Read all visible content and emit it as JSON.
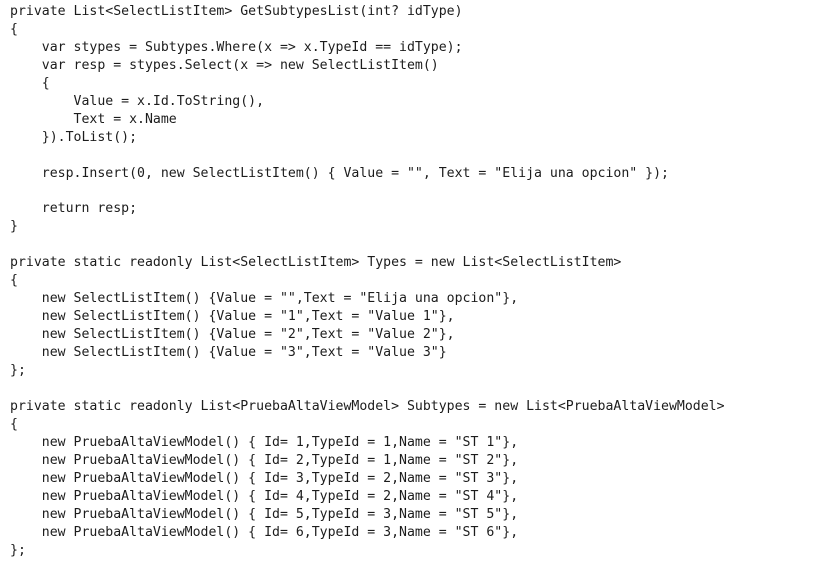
{
  "document": {
    "kind": "source-code-snippet",
    "language": "C#",
    "background_color": "#ffffff",
    "text_color": "#1c1c1c",
    "font_style": "monospace",
    "font_size_px": 13.2,
    "line_height_px": 17.95,
    "indent_unit_spaces": 4,
    "total_lines": 31
  },
  "code": {
    "lines": [
      "private List<SelectListItem> GetSubtypesList(int? idType)",
      "{",
      "    var stypes = Subtypes.Where(x => x.TypeId == idType);",
      "    var resp = stypes.Select(x => new SelectListItem()",
      "    {",
      "        Value = x.Id.ToString(),",
      "        Text = x.Name",
      "    }).ToList();",
      "",
      "    resp.Insert(0, new SelectListItem() { Value = \"\", Text = \"Elija una opcion\" });",
      "",
      "    return resp;",
      "}",
      "",
      "private static readonly List<SelectListItem> Types = new List<SelectListItem>",
      "{",
      "    new SelectListItem() {Value = \"\",Text = \"Elija una opcion\"},",
      "    new SelectListItem() {Value = \"1\",Text = \"Value 1\"},",
      "    new SelectListItem() {Value = \"2\",Text = \"Value 2\"},",
      "    new SelectListItem() {Value = \"3\",Text = \"Value 3\"}",
      "};",
      "",
      "private static readonly List<PruebaAltaViewModel> Subtypes = new List<PruebaAltaViewModel>",
      "{",
      "    new PruebaAltaViewModel() { Id= 1,TypeId = 1,Name = \"ST 1\"},",
      "    new PruebaAltaViewModel() { Id= 2,TypeId = 1,Name = \"ST 2\"},",
      "    new PruebaAltaViewModel() { Id= 3,TypeId = 2,Name = \"ST 3\"},",
      "    new PruebaAltaViewModel() { Id= 4,TypeId = 2,Name = \"ST 4\"},",
      "    new PruebaAltaViewModel() { Id= 5,TypeId = 3,Name = \"ST 5\"},",
      "    new PruebaAltaViewModel() { Id= 6,TypeId = 3,Name = \"ST 6\"},",
      "};"
    ]
  },
  "semantics": {
    "methods": [
      {
        "name": "GetSubtypesList",
        "access_modifier": "private",
        "return_type": "List<SelectListItem>",
        "parameters": "int? idType"
      }
    ],
    "fields": [
      {
        "name": "Types",
        "access_modifier": "private",
        "modifiers": "static readonly",
        "type": "List<SelectListItem>",
        "items": [
          {
            "Value": "",
            "Text": "Elija una opcion"
          },
          {
            "Value": "1",
            "Text": "Value 1"
          },
          {
            "Value": "2",
            "Text": "Value 2"
          },
          {
            "Value": "3",
            "Text": "Value 3"
          }
        ]
      },
      {
        "name": "Subtypes",
        "access_modifier": "private",
        "modifiers": "static readonly",
        "type": "List<PruebaAltaViewModel>",
        "items": [
          {
            "Id": 1,
            "TypeId": 1,
            "Name": "ST 1"
          },
          {
            "Id": 2,
            "TypeId": 1,
            "Name": "ST 2"
          },
          {
            "Id": 3,
            "TypeId": 2,
            "Name": "ST 3"
          },
          {
            "Id": 4,
            "TypeId": 2,
            "Name": "ST 4"
          },
          {
            "Id": 5,
            "TypeId": 3,
            "Name": "ST 5"
          },
          {
            "Id": 6,
            "TypeId": 3,
            "Name": "ST 6"
          }
        ]
      }
    ]
  }
}
